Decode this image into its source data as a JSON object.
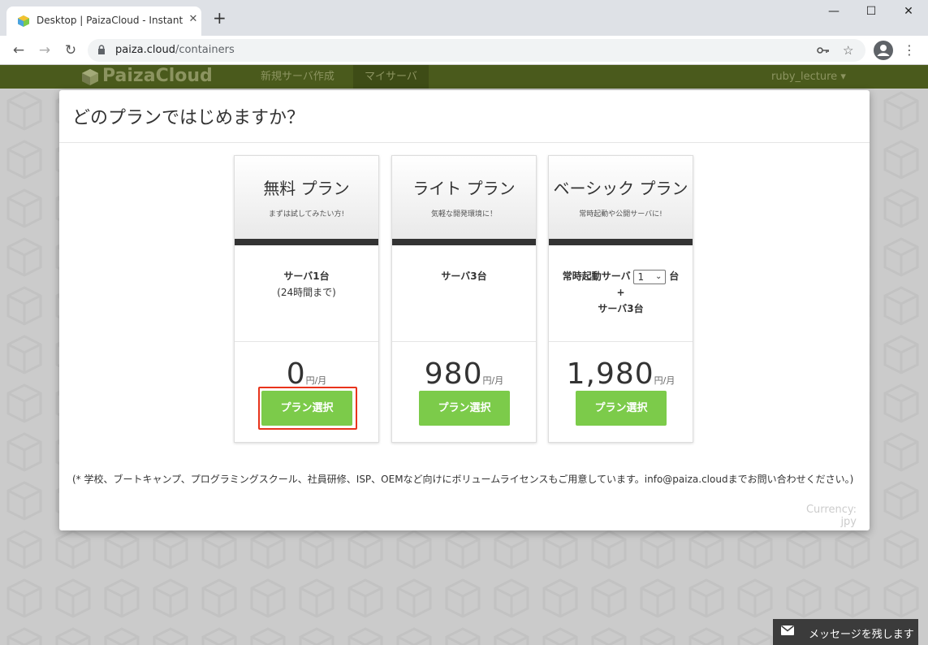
{
  "browser": {
    "tab_title": "Desktop | PaizaCloud - Instant Lin",
    "tab_close": "✕",
    "new_tab": "+",
    "url_host": "paiza.cloud",
    "url_path": "/containers",
    "window_controls": {
      "minimize": "—",
      "maximize": "☐",
      "close": "✕"
    }
  },
  "appnav": {
    "logo_text": "PaizaCloud",
    "links": [
      "新規サーバ作成",
      "マイサーバ"
    ],
    "active_link": "マイサーバ",
    "user": "ruby_lecture ▾"
  },
  "modal": {
    "title": "どのプランではじめますか？",
    "plans": [
      {
        "name": "無料 プラン",
        "tagline": "まずは試してみたい方!",
        "servers": "サーバ1台",
        "servers_note": "(24時間まで)",
        "price": "0",
        "price_unit": "円/月",
        "button": "プラン選択"
      },
      {
        "name": "ライト プラン",
        "tagline": "気軽な開発環境に！",
        "servers": "サーバ3台",
        "price": "980",
        "price_unit": "円/月",
        "button": "プラン選択"
      },
      {
        "name": "ベーシック プラン",
        "tagline": "常時起動や公開サーバに!",
        "always_on_label": "常時起動サーバ",
        "always_on_value": "1",
        "always_on_suffix": "台",
        "plus": "+",
        "servers": "サーバ3台",
        "price": "1,980",
        "price_unit": "円/月",
        "button": "プラン選択"
      }
    ],
    "footnote": "(* 学校、ブートキャンプ、プログラミングスクール、社員研修、ISP、OEMなど向けにボリュームライセンスもご用意しています。info@paiza.cloudまでお問い合わせください。)",
    "currency": "Currency: jpy"
  },
  "message_widget": {
    "label": "メッセージを残します"
  },
  "colors": {
    "accent_green": "#7ccb4a",
    "nav_bg": "#4a5a1c",
    "highlight_red": "#e8341c"
  }
}
